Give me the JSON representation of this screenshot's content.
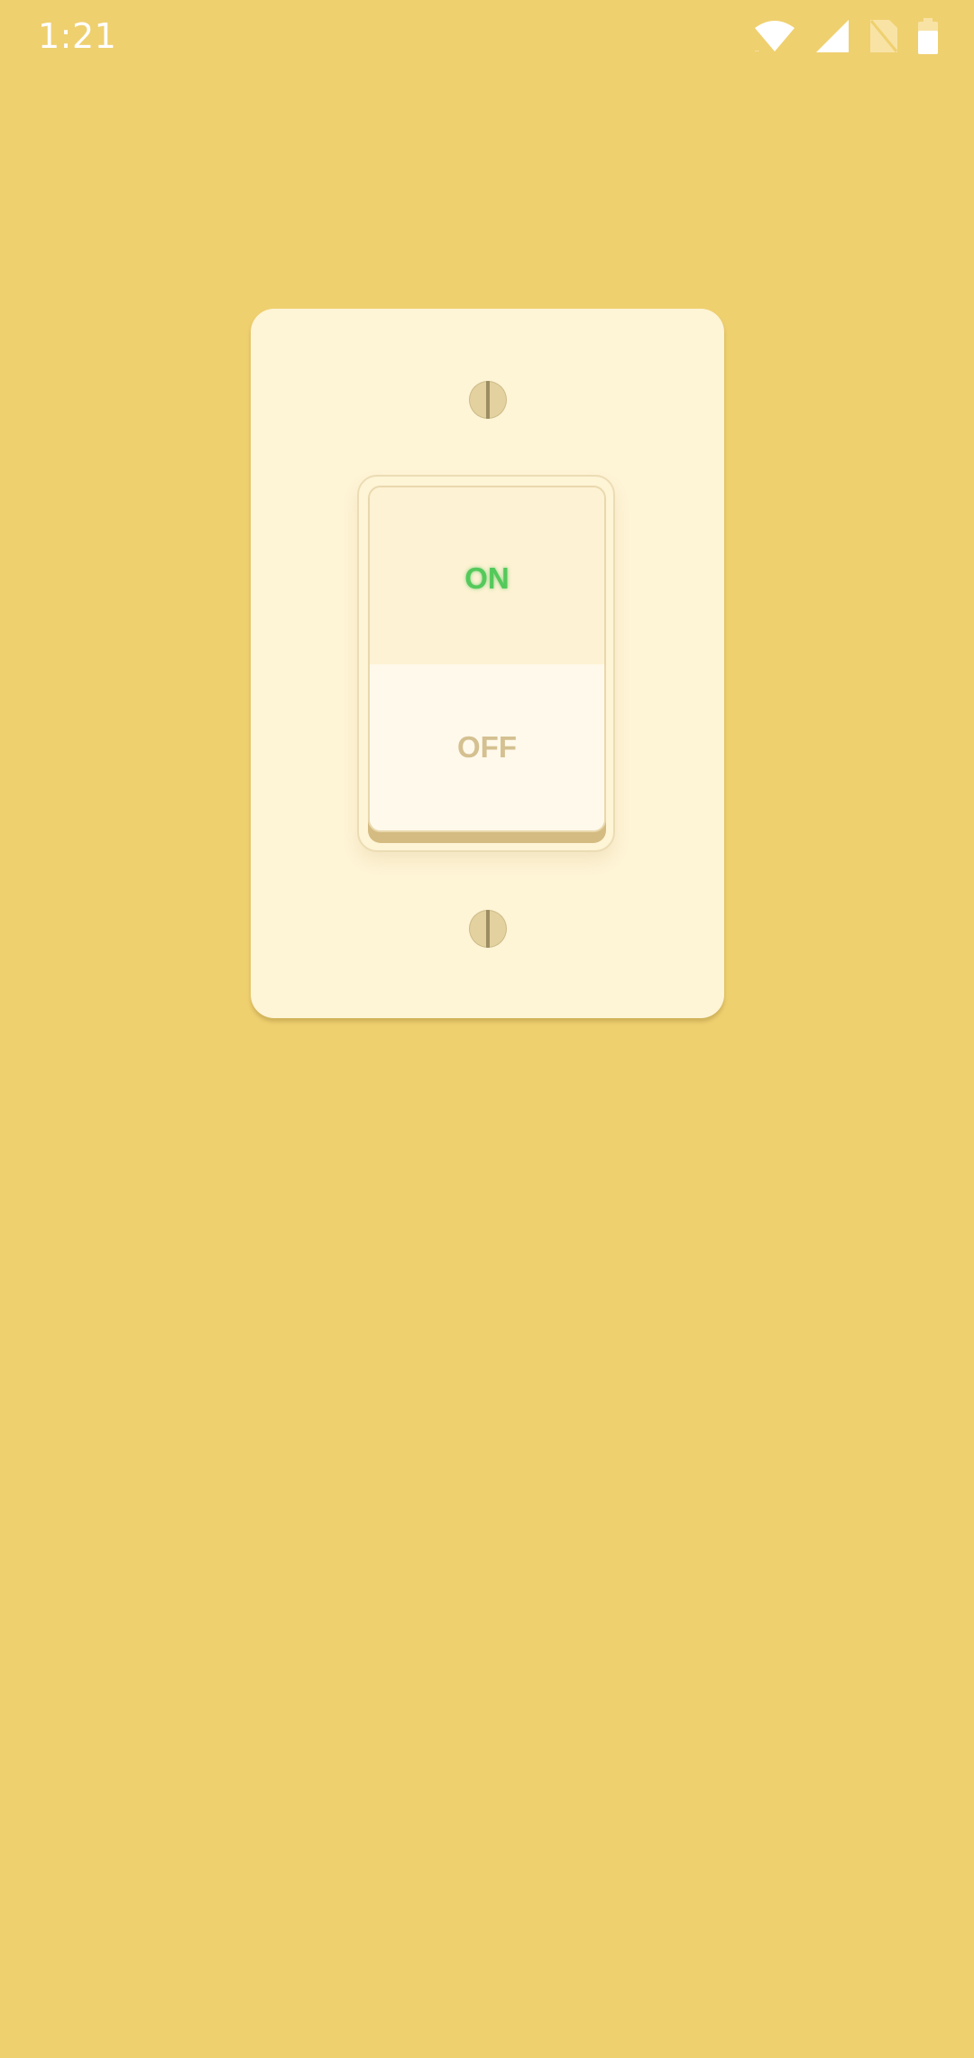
{
  "status_bar": {
    "time": "1:21",
    "icons": [
      "wifi-icon",
      "cell-signal-icon",
      "no-sim-icon",
      "battery-icon"
    ]
  },
  "switch": {
    "on_label": "ON",
    "off_label": "OFF",
    "state": "on"
  },
  "colors": {
    "background": "#efd06f",
    "plate": "#fef4d6",
    "on_label": "#54c95b",
    "off_label": "#d4c090"
  }
}
